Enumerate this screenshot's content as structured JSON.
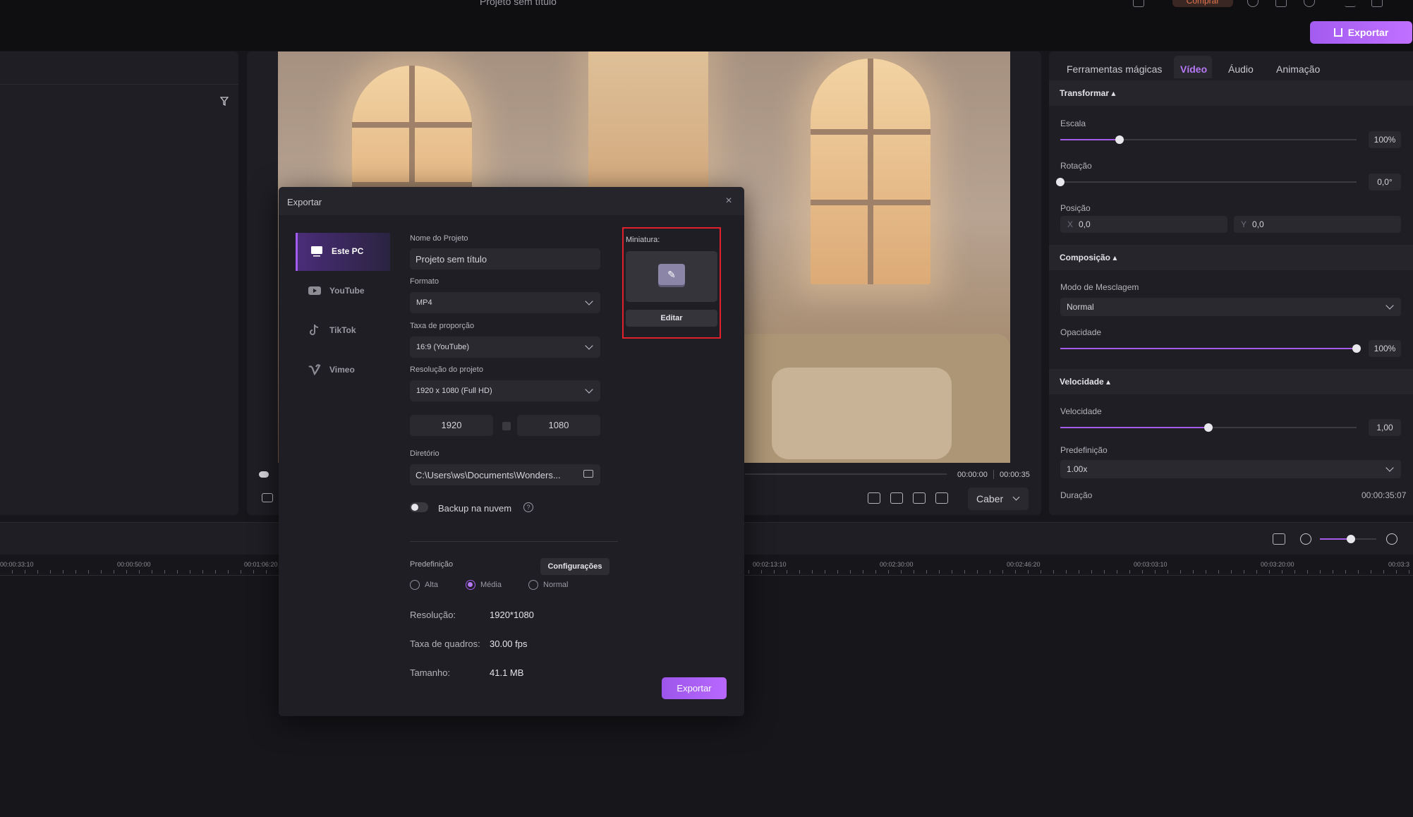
{
  "app": {
    "title": "Projeto sem título",
    "buy_label": "Comprar",
    "export_label": "Exportar"
  },
  "preview": {
    "time_current": "00:00:00",
    "time_total": "00:00:35",
    "fit_label": "Caber"
  },
  "props": {
    "tabs": [
      "Ferramentas mágicas",
      "Vídeo",
      "Áudio",
      "Animação"
    ],
    "active_tab": "Vídeo",
    "transform": {
      "header": "Transformar",
      "scale_label": "Escala",
      "scale_value": "100%",
      "scale_level": 0.2,
      "rotation_label": "Rotação",
      "rotation_value": "0,0°",
      "rotation_level": 0.0,
      "position_label": "Posição",
      "pos_x_axis": "X",
      "pos_x": "0,0",
      "pos_y_axis": "Y",
      "pos_y": "0,0"
    },
    "composition": {
      "header": "Composição",
      "blend_label": "Modo de Mesclagem",
      "blend_value": "Normal",
      "opacity_label": "Opacidade",
      "opacity_value": "100%",
      "opacity_level": 1.0
    },
    "speed": {
      "header": "Velocidade",
      "speed_label": "Velocidade",
      "speed_value": "1,00",
      "speed_level": 0.5,
      "preset_label": "Predefinição",
      "preset_value": "1.00x",
      "duration_label": "Duração",
      "duration_value": "00:00:35:07"
    }
  },
  "timeline": {
    "ruler_labels": [
      "00:00:33:10",
      "00:00:50:00",
      "00:01:06:20",
      "00:02:13:10",
      "00:02:30:00",
      "00:02:46:20",
      "00:03:03:10",
      "00:03:20:00",
      "00:03:3"
    ],
    "zoom_level": 0.55
  },
  "dialog": {
    "title": "Exportar",
    "close_glyph": "×",
    "nav": [
      {
        "label": "Este PC",
        "icon": "monitor-icon",
        "active": true
      },
      {
        "label": "YouTube",
        "icon": "youtube-icon",
        "active": false
      },
      {
        "label": "TikTok",
        "icon": "tiktok-icon",
        "active": false
      },
      {
        "label": "Vimeo",
        "icon": "vimeo-icon",
        "active": false
      }
    ],
    "project_name_label": "Nome do Projeto",
    "project_name": "Projeto sem título",
    "format_label": "Formato",
    "format_value": "MP4",
    "aspect_label": "Taxa de proporção",
    "aspect_value": "16:9 (YouTube)",
    "resolution_label": "Resolução do projeto",
    "resolution_value": "1920 x 1080 (Full HD)",
    "width": "1920",
    "height": "1080",
    "directory_label": "Diretório",
    "directory_value": "C:\\Users\\ws\\Documents\\Wonders...",
    "backup_label": "Backup na nuvem",
    "help_glyph": "?",
    "preset_label": "Predefinição",
    "config_label": "Configurações",
    "quality_options": [
      {
        "label": "Alta",
        "selected": false
      },
      {
        "label": "Média",
        "selected": true
      },
      {
        "label": "Normal",
        "selected": false
      }
    ],
    "info": {
      "resolution_key": "Resolução:",
      "resolution_val": "1920*1080",
      "framerate_key": "Taxa de quadros:",
      "framerate_val": "30.00 fps",
      "size_key": "Tamanho:",
      "size_val": "41.1 MB"
    },
    "thumbnail_label": "Miniatura:",
    "thumbnail_edit_label": "Editar",
    "export_label": "Exportar",
    "accent": "#a35cf0",
    "highlight": "#e0202a"
  }
}
